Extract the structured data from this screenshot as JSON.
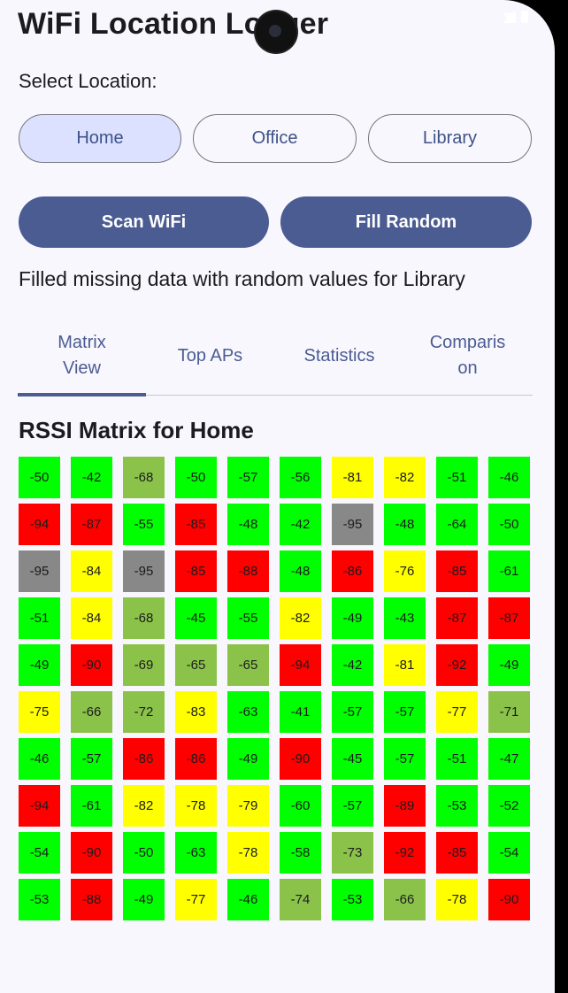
{
  "app": {
    "title": "WiFi Location Logger"
  },
  "location": {
    "label": "Select Location:",
    "options": [
      "Home",
      "Office",
      "Library"
    ],
    "selected": "Home"
  },
  "actions": {
    "scan": "Scan WiFi",
    "fill": "Fill Random"
  },
  "status_message": "Filled missing data with random values for Library",
  "tabs": {
    "items": [
      "Matrix View",
      "Top APs",
      "Statistics",
      "Comparison"
    ],
    "selected": "Matrix View"
  },
  "matrix": {
    "title": "RSSI Matrix for Home",
    "colors": {
      "strong": "#00ff00",
      "good": "#8bc34a",
      "weak": "#ffff00",
      "poor": "#ff0000",
      "missing": "#888888"
    },
    "rows": [
      [
        -50,
        -42,
        -68,
        -50,
        -57,
        -56,
        -81,
        -82,
        -51,
        -46
      ],
      [
        -94,
        -87,
        -55,
        -85,
        -48,
        -42,
        -95,
        -48,
        -64,
        -50
      ],
      [
        -95,
        -84,
        -95,
        -85,
        -88,
        -48,
        -86,
        -76,
        -85,
        -61
      ],
      [
        -51,
        -84,
        -68,
        -45,
        -55,
        -82,
        -49,
        -43,
        -87,
        -87
      ],
      [
        -49,
        -90,
        -69,
        -65,
        -65,
        -94,
        -42,
        -81,
        -92,
        -49
      ],
      [
        -75,
        -66,
        -72,
        -83,
        -63,
        -41,
        -57,
        -57,
        -77,
        -71
      ],
      [
        -46,
        -57,
        -86,
        -86,
        -49,
        -90,
        -45,
        -57,
        -51,
        -47
      ],
      [
        -94,
        -61,
        -82,
        -78,
        -79,
        -60,
        -57,
        -89,
        -53,
        -52
      ],
      [
        -54,
        -90,
        -50,
        -63,
        -78,
        -58,
        -73,
        -92,
        -85,
        -54
      ],
      [
        -53,
        -88,
        -49,
        -77,
        -46,
        -74,
        -53,
        -66,
        -78,
        -90
      ]
    ],
    "cell_colors": [
      [
        "strong",
        "strong",
        "good",
        "strong",
        "strong",
        "strong",
        "weak",
        "weak",
        "strong",
        "strong"
      ],
      [
        "poor",
        "poor",
        "strong",
        "poor",
        "strong",
        "strong",
        "missing",
        "strong",
        "strong",
        "strong"
      ],
      [
        "missing",
        "weak",
        "missing",
        "poor",
        "poor",
        "strong",
        "poor",
        "weak",
        "poor",
        "strong"
      ],
      [
        "strong",
        "weak",
        "good",
        "strong",
        "strong",
        "weak",
        "strong",
        "strong",
        "poor",
        "poor"
      ],
      [
        "strong",
        "poor",
        "good",
        "good",
        "good",
        "poor",
        "strong",
        "weak",
        "poor",
        "strong"
      ],
      [
        "weak",
        "good",
        "good",
        "weak",
        "strong",
        "strong",
        "strong",
        "strong",
        "weak",
        "good"
      ],
      [
        "strong",
        "strong",
        "poor",
        "poor",
        "strong",
        "poor",
        "strong",
        "strong",
        "strong",
        "strong"
      ],
      [
        "poor",
        "strong",
        "weak",
        "weak",
        "weak",
        "strong",
        "strong",
        "poor",
        "strong",
        "strong"
      ],
      [
        "strong",
        "poor",
        "strong",
        "strong",
        "weak",
        "strong",
        "good",
        "poor",
        "poor",
        "strong"
      ],
      [
        "strong",
        "poor",
        "strong",
        "weak",
        "strong",
        "good",
        "strong",
        "good",
        "weak",
        "poor"
      ]
    ]
  }
}
